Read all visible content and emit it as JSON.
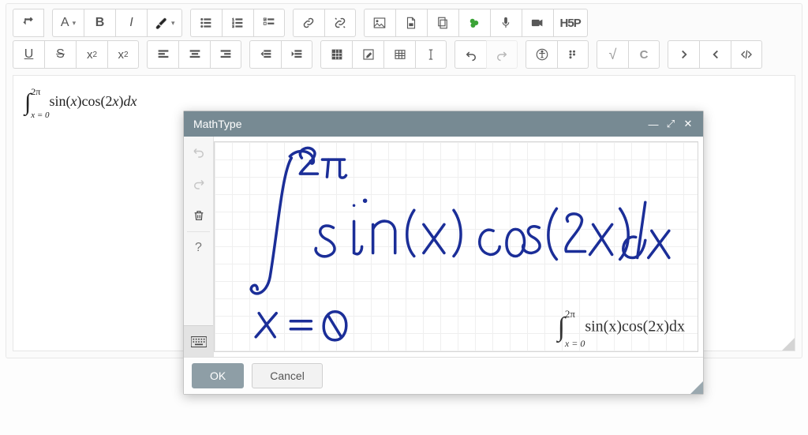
{
  "toolbar": {
    "font_label": "A",
    "bold_label": "B",
    "italic_label": "I",
    "underline_label": "U",
    "strike_label": "S",
    "sub_label": "x",
    "sub_index": "2",
    "sup_label": "x",
    "sup_index": "2",
    "h5p_label": "H5P",
    "sqrt_label": "√",
    "chem_label": "C"
  },
  "editor": {
    "math_html": "∫",
    "math_upper": "2π",
    "math_lower": "x = 0",
    "math_body_prefix": "sin(",
    "math_x": "x",
    "math_mid": ")cos(2",
    "math_x2": "x",
    "math_suffix": ")",
    "math_dx": "dx"
  },
  "mathtype": {
    "title": "MathType",
    "ok_label": "OK",
    "cancel_label": "Cancel",
    "help_label": "?",
    "handwritten_expression": "∫ from x=0 to 2π of sin(x) cos(2x) dx",
    "preview": {
      "int": "∫",
      "upper": "2π",
      "lower": "x = 0",
      "body_a": "sin(",
      "x": "x",
      "body_b": ")cos(2",
      "x2": "x",
      "body_c": ")",
      "dx": "dx"
    }
  }
}
